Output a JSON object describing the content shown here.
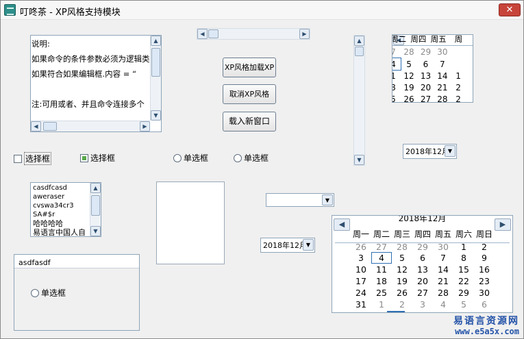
{
  "window": {
    "title": "叮咚茶 - XP风格支持模块",
    "close_glyph": "✕"
  },
  "memo": {
    "lines": [
      "说明:",
      "如果命令的条件参数必须为逻辑类",
      "如果符合如果编辑框.内容 = “",
      "",
      "注:可用或者、并且命令连接多个"
    ]
  },
  "buttons": {
    "xp_load": "XP风格加载XP",
    "xp_cancel": "取消XP风格",
    "new_window": "载入新窗口"
  },
  "checkboxes": [
    {
      "label": "选择框",
      "checked": false
    },
    {
      "label": "选择框",
      "checked": true
    }
  ],
  "radios": [
    {
      "label": "单选框"
    },
    {
      "label": "单选框"
    }
  ],
  "listbox": {
    "items": [
      "casdfcasd",
      "aweraser",
      "cvswa34cr3",
      "SA#$r",
      "哈哈哈哈",
      "易语言中国人自"
    ]
  },
  "groupbox": {
    "title": "asdfasdf",
    "radio_label": "单选框"
  },
  "date_combo_right": {
    "value": "2018年12月"
  },
  "date_combo_left": {
    "value": "2018年12月"
  },
  "empty_combo": {
    "value": ""
  },
  "small_calendar": {
    "header": [
      "周二",
      "周四",
      "周五",
      "周"
    ],
    "rows": [
      [
        "7",
        "28",
        "29",
        "30",
        ""
      ],
      [
        "4",
        "5",
        "6",
        "7",
        ""
      ],
      [
        "1",
        "12",
        "13",
        "14",
        "1"
      ],
      [
        "8",
        "19",
        "20",
        "21",
        "2"
      ],
      [
        "5",
        "26",
        "27",
        "28",
        "2"
      ]
    ]
  },
  "big_calendar": {
    "month": "2018年12月",
    "weekdays": [
      "周一",
      "周二",
      "周三",
      "周四",
      "周五",
      "周六",
      "周日"
    ],
    "rows": [
      [
        "26",
        "27",
        "28",
        "29",
        "30",
        "1",
        "2"
      ],
      [
        "3",
        "4",
        "5",
        "6",
        "7",
        "8",
        "9"
      ],
      [
        "10",
        "11",
        "12",
        "13",
        "14",
        "15",
        "16"
      ],
      [
        "17",
        "18",
        "19",
        "20",
        "21",
        "22",
        "23"
      ],
      [
        "24",
        "25",
        "26",
        "27",
        "28",
        "29",
        "30"
      ],
      [
        "31",
        "1",
        "2",
        "3",
        "4",
        "5",
        "6"
      ]
    ],
    "today": "4",
    "colors": {
      "grey": "#8a8a8a",
      "accent": "#2f6fb3"
    }
  },
  "watermark": {
    "line1": "易语言资源网",
    "line2": "www.e5a5x.com"
  }
}
